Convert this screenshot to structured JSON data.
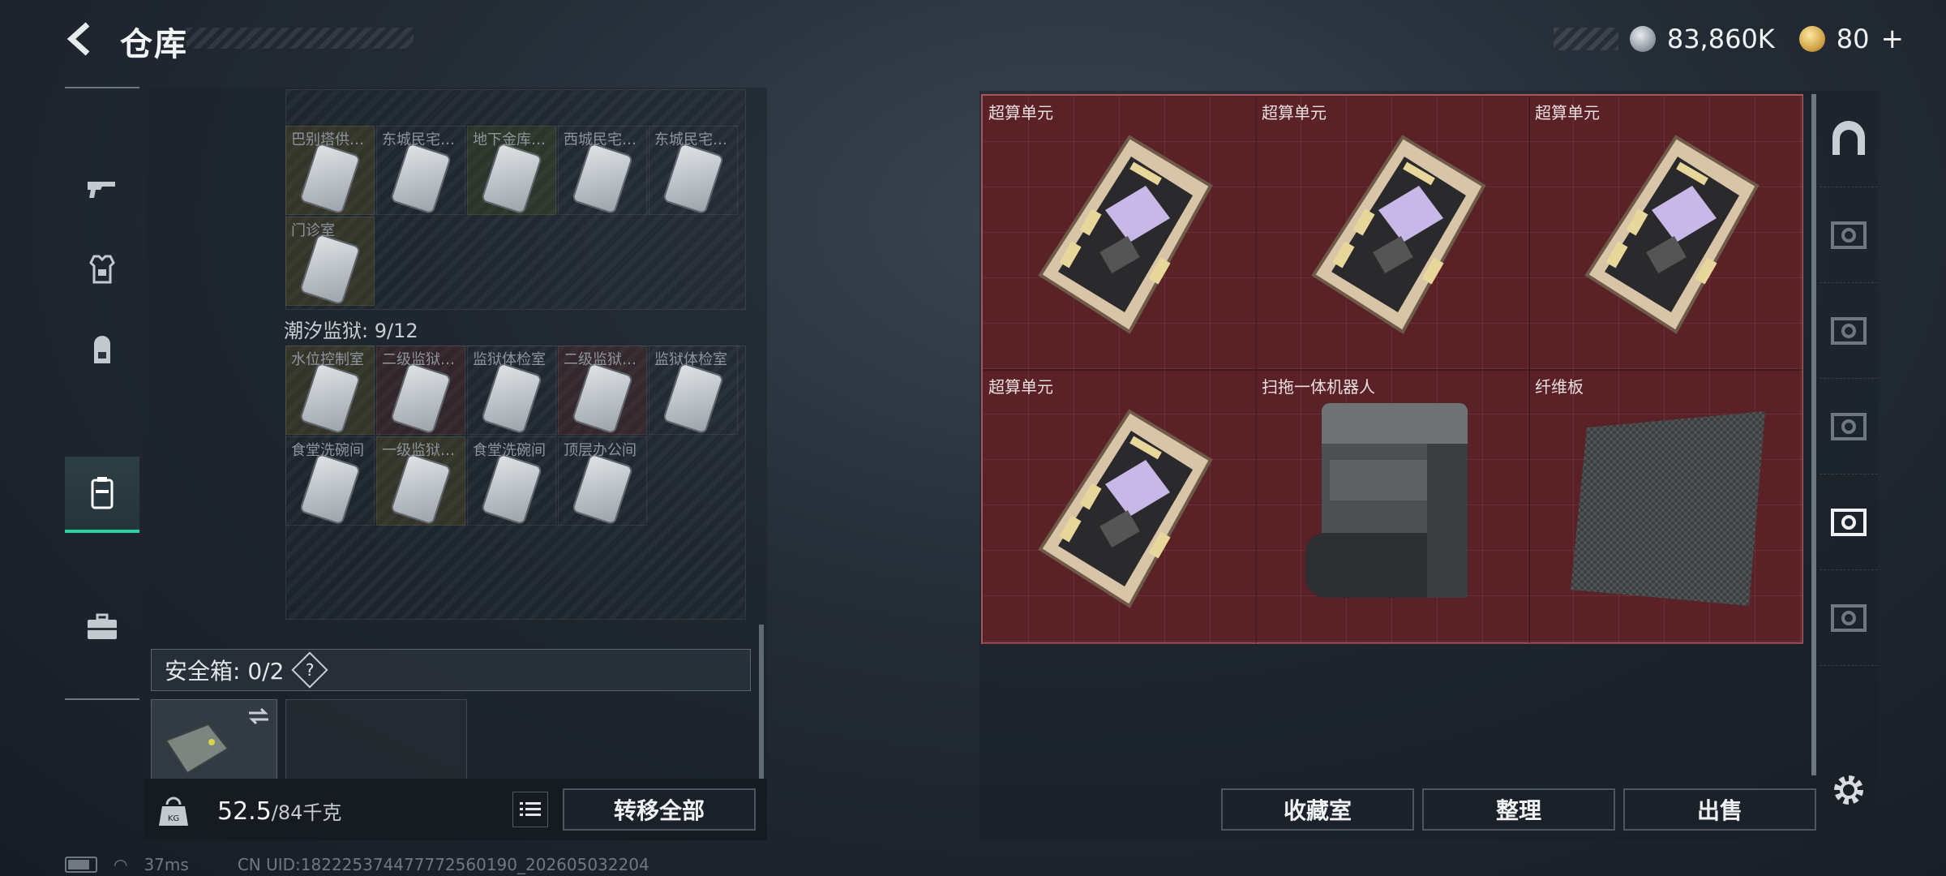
{
  "header": {
    "title": "仓库",
    "silver_amount": "83,860K",
    "gold_amount": "80"
  },
  "left": {
    "group1": [
      {
        "label": "巴别塔供…",
        "tint": "yellow"
      },
      {
        "label": "东城民宅…",
        "tint": "none"
      },
      {
        "label": "地下金库…",
        "tint": "olive"
      },
      {
        "label": "西城民宅…",
        "tint": "none"
      },
      {
        "label": "东城民宅…",
        "tint": "none"
      },
      {
        "label": "门诊室",
        "tint": "yellow"
      }
    ],
    "section_label": "潮汐监狱: 9/12",
    "group2": [
      {
        "label": "水位控制室",
        "tint": "yellow"
      },
      {
        "label": "二级监狱…",
        "tint": "red"
      },
      {
        "label": "监狱体检室",
        "tint": "none"
      },
      {
        "label": "二级监狱…",
        "tint": "red"
      },
      {
        "label": "监狱体检室",
        "tint": "none"
      },
      {
        "label": "食堂洗碗间",
        "tint": "none"
      },
      {
        "label": "一级监狱…",
        "tint": "yellow"
      },
      {
        "label": "食堂洗碗间",
        "tint": "none"
      },
      {
        "label": "顶层办公间",
        "tint": "none"
      }
    ],
    "safe_box_label": "安全箱: 0/2",
    "safe_box_help": "?",
    "weight_current": "52.5",
    "weight_max": "/84千克",
    "transfer_all": "转移全部"
  },
  "right": {
    "items": [
      {
        "label": "超算单元",
        "icon": "circuit-board"
      },
      {
        "label": "超算单元",
        "icon": "circuit-board"
      },
      {
        "label": "超算单元",
        "icon": "circuit-board"
      },
      {
        "label": "超算单元",
        "icon": "circuit-board"
      },
      {
        "label": "扫拖一体机器人",
        "icon": "robot-vacuum"
      },
      {
        "label": "纤维板",
        "icon": "carbon-fiber-board"
      }
    ],
    "buttons": {
      "collection": "收藏室",
      "sort": "整理",
      "sell": "出售"
    }
  },
  "status": {
    "ping": "37ms",
    "uid": "CN UID:182225374477772560190_202605032204"
  },
  "colors": {
    "accent_green": "#27d6a0",
    "item_bg": "#5a2127",
    "item_border": "#a7565b"
  }
}
